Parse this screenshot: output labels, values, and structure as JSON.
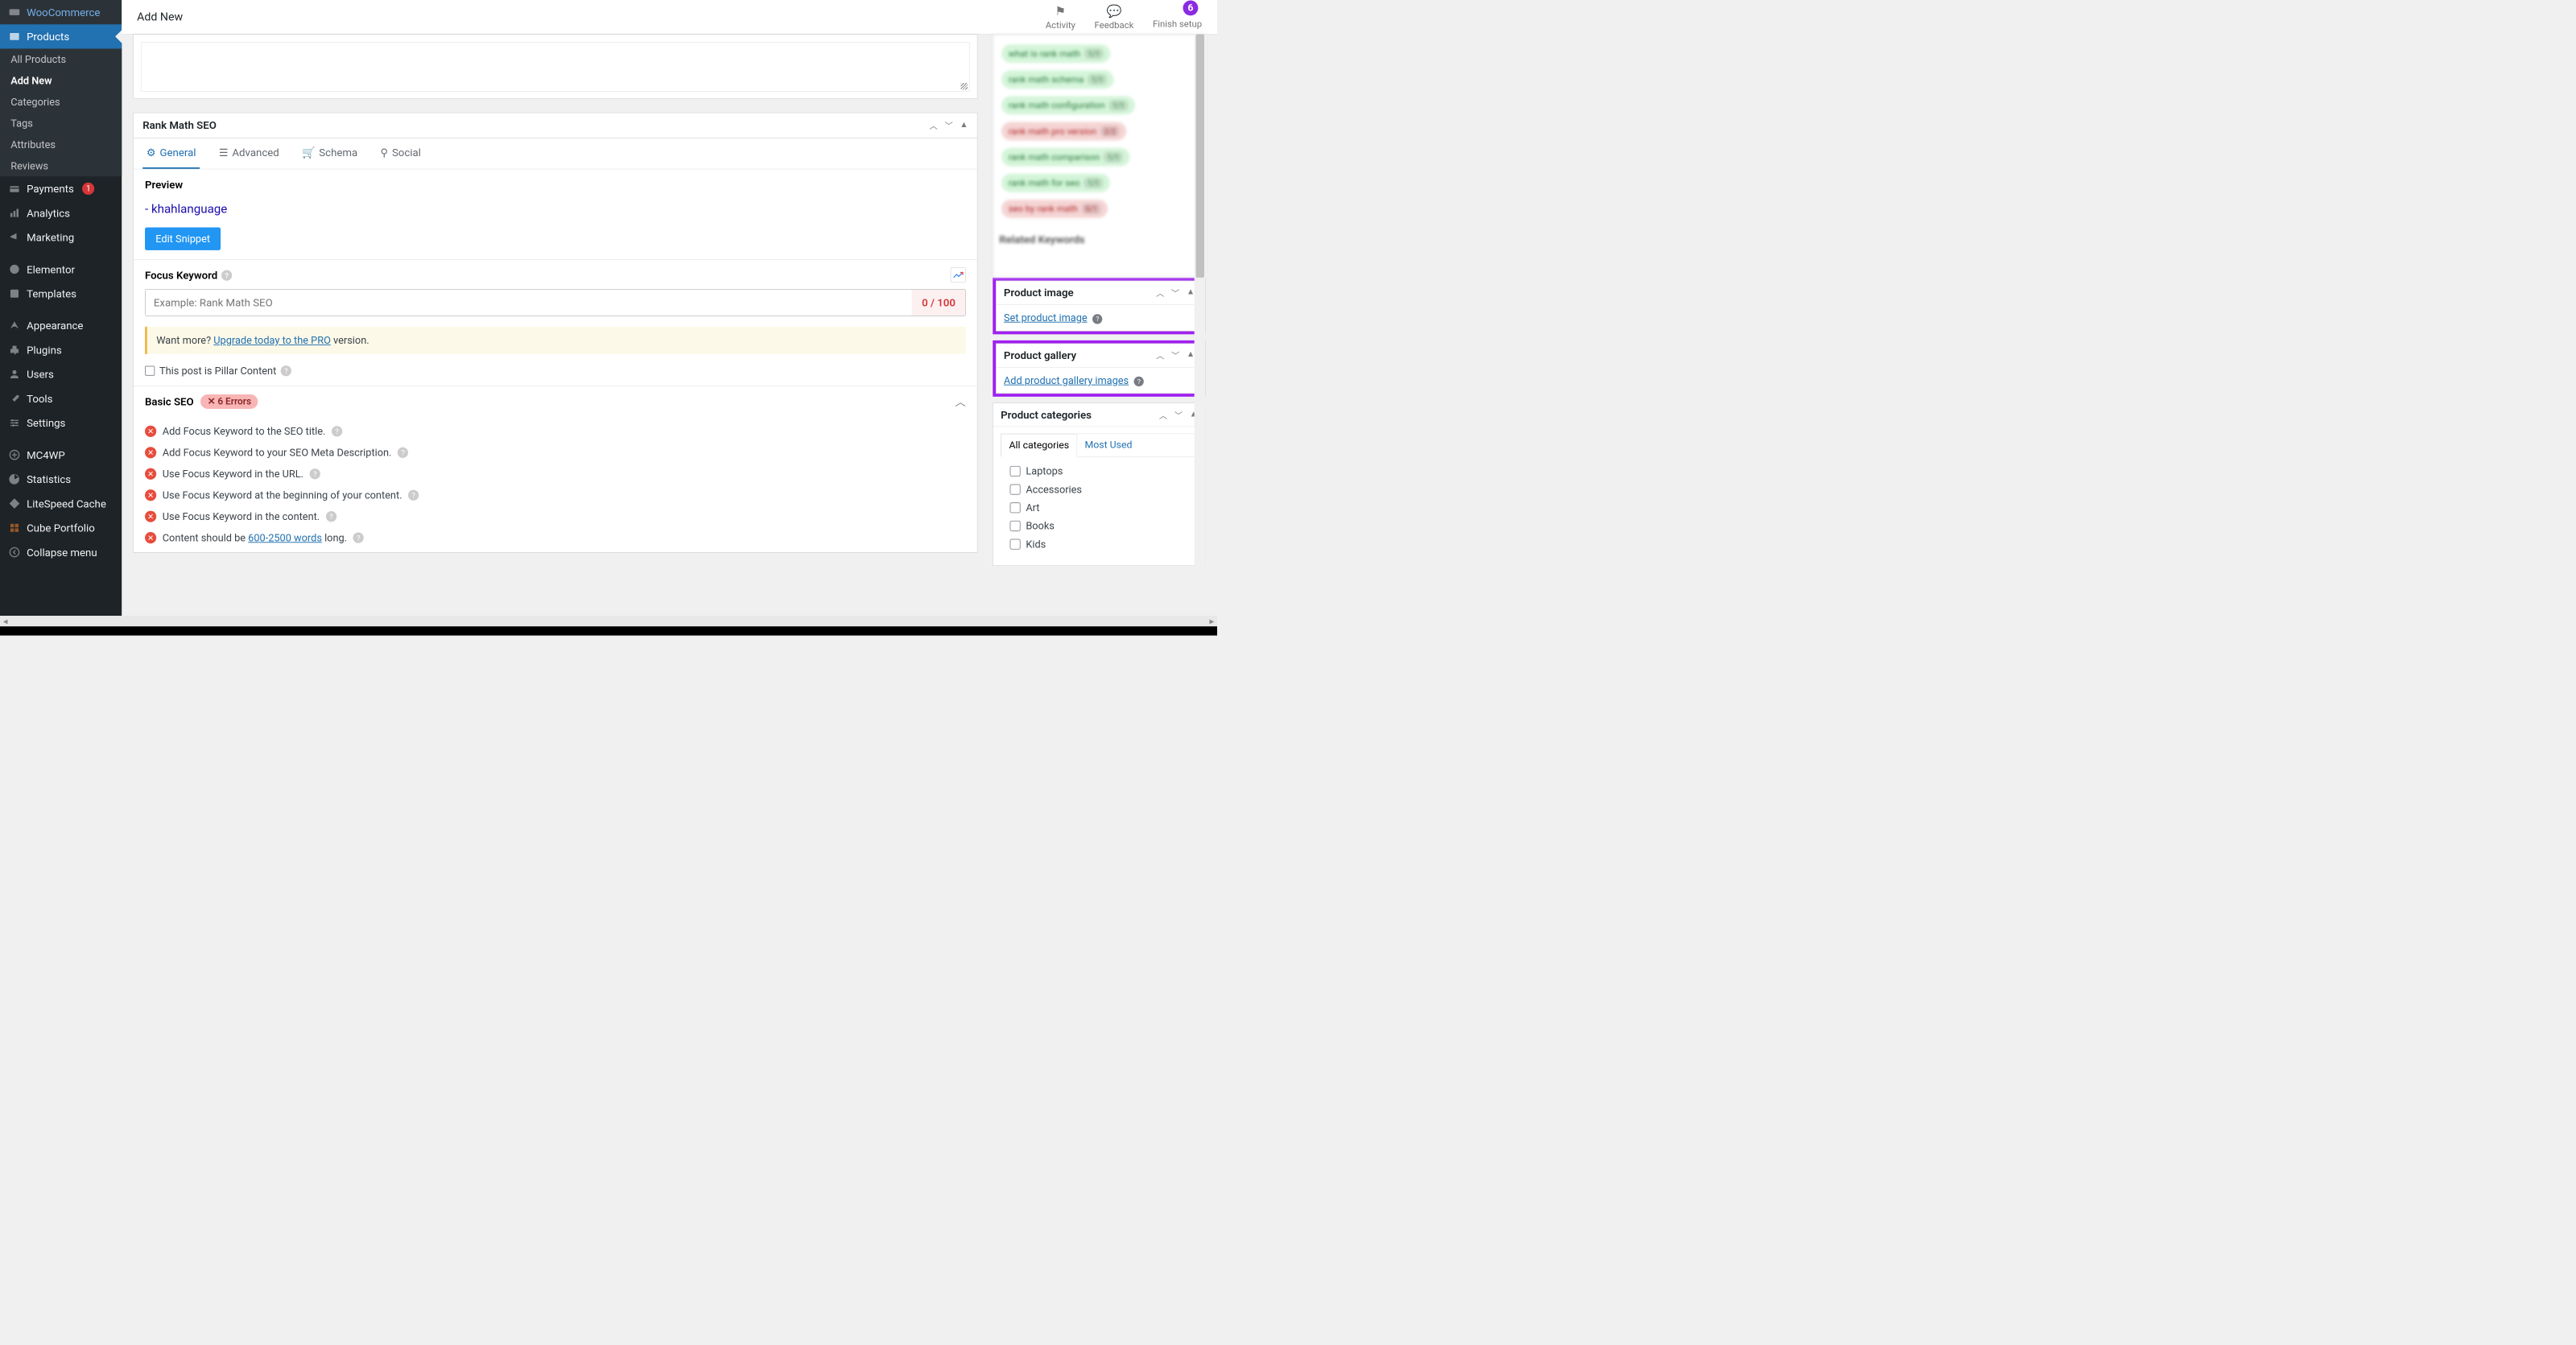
{
  "topbar": {
    "page_title": "Add New",
    "activity": "Activity",
    "feedback": "Feedback",
    "finish": "Finish setup",
    "finish_badge": "6"
  },
  "sidebar": {
    "woocommerce": "WooCommerce",
    "products": "Products",
    "sub": {
      "all": "All Products",
      "add": "Add New",
      "cat": "Categories",
      "tags": "Tags",
      "attr": "Attributes",
      "rev": "Reviews"
    },
    "payments": "Payments",
    "payments_badge": "1",
    "analytics": "Analytics",
    "marketing": "Marketing",
    "elementor": "Elementor",
    "templates": "Templates",
    "appearance": "Appearance",
    "plugins": "Plugins",
    "users": "Users",
    "tools": "Tools",
    "settings": "Settings",
    "mc4wp": "MC4WP",
    "statistics": "Statistics",
    "litespeed": "LiteSpeed Cache",
    "cube": "Cube Portfolio",
    "collapse": "Collapse menu"
  },
  "seo": {
    "panel_title": "Rank Math SEO",
    "tabs": {
      "general": "General",
      "advanced": "Advanced",
      "schema": "Schema",
      "social": "Social"
    },
    "preview_label": "Preview",
    "preview_url": "- khahlanguage",
    "edit_snippet": "Edit Snippet",
    "focus_keyword": "Focus Keyword",
    "fk_placeholder": "Example: Rank Math SEO",
    "fk_score": "0 / 100",
    "want_more_pre": "Want more? ",
    "want_more_link": "Upgrade today to the PRO",
    "want_more_post": " version.",
    "pillar": "This post is Pillar Content",
    "basic_seo": "Basic SEO",
    "errors_count": "6 Errors",
    "items": [
      "Add Focus Keyword to the SEO title.",
      "Add Focus Keyword to your SEO Meta Description.",
      "Use Focus Keyword in the URL.",
      "Use Focus Keyword at the beginning of your content.",
      "Use Focus Keyword in the content."
    ],
    "content_pre": "Content should be ",
    "content_link": "600-2500 words",
    "content_post": " long."
  },
  "blur_keywords": [
    {
      "label": "what is rank math",
      "score": "1/1",
      "cls": "green"
    },
    {
      "label": "rank math schema",
      "score": "1/1",
      "cls": "green"
    },
    {
      "label": "rank math configuration",
      "score": "1/1",
      "cls": "green"
    },
    {
      "label": "rank math pro version",
      "score": "2/2",
      "cls": "red"
    },
    {
      "label": "rank math comparison",
      "score": "1/1",
      "cls": "green"
    },
    {
      "label": "rank math for seo",
      "score": "1/1",
      "cls": "green"
    },
    {
      "label": "seo by rank math",
      "score": "0/1",
      "cls": "red"
    }
  ],
  "related_keywords": "Related Keywords",
  "product_image": {
    "title": "Product image",
    "link": "Set product image"
  },
  "product_gallery": {
    "title": "Product gallery",
    "link": "Add product gallery images"
  },
  "product_categories": {
    "title": "Product categories",
    "all_tab": "All categories",
    "most_tab": "Most Used",
    "items": [
      "Laptops",
      "Accessories",
      "Art",
      "Books",
      "Kids"
    ]
  }
}
